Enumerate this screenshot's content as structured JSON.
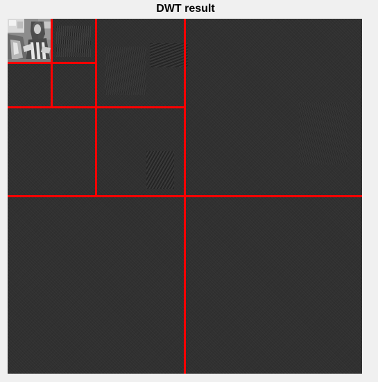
{
  "figure": {
    "title": "DWT result"
  },
  "colors": {
    "background": "#f0f0f0",
    "plot_area": "#303030",
    "separator_lines": "#ff0000"
  },
  "decomposition": {
    "levels": 3
  }
}
